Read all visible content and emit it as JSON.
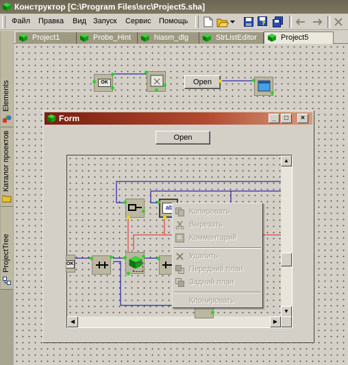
{
  "window": {
    "title": "Конструктор [C:\\Program Files\\src\\Project5.sha]"
  },
  "menu": [
    "Файл",
    "Правка",
    "Вид",
    "Запуск",
    "Сервис",
    "Помощь"
  ],
  "toolbar": {
    "icons": [
      "new-file-icon",
      "open-folder-icon",
      "dropdown-arrow-icon",
      "save-icon",
      "save-as-icon",
      "save-all-icon",
      "back-arrow-icon",
      "forward-arrow-icon",
      "close-icon"
    ]
  },
  "tabs": [
    {
      "label": "Project1",
      "active": false
    },
    {
      "label": "Probe_Hint",
      "active": false
    },
    {
      "label": "hiasm_dlg",
      "active": false
    },
    {
      "label": "StrListEditor",
      "active": false
    },
    {
      "label": "Project5",
      "active": true
    }
  ],
  "sidebar": [
    {
      "label": "Elements",
      "icon": "elements-icon"
    },
    {
      "label": "Каталог проектов",
      "icon": "folder-icon"
    },
    {
      "label": "ProjectTree",
      "icon": "tree-icon"
    }
  ],
  "canvas": {
    "ok_label": "OK",
    "open_button": "Open"
  },
  "form": {
    "title": "Form",
    "open_button": "Open",
    "caption_buttons": [
      "_",
      "□",
      "×"
    ],
    "ok_label": "OK",
    "edit_label": "ab"
  },
  "context_menu": {
    "items": [
      {
        "label": "Копировать",
        "icon": "copy-icon"
      },
      {
        "label": "Вырезать",
        "icon": "cut-icon"
      },
      {
        "label": "Комментарий",
        "icon": "comment-icon"
      },
      {
        "separator": true
      },
      {
        "label": "Удалить",
        "icon": "delete-icon"
      },
      {
        "label": "Передний план",
        "icon": "bring-front-icon"
      },
      {
        "label": "Задний план",
        "icon": "send-back-icon"
      },
      {
        "separator": true
      },
      {
        "label": "Клонировать",
        "icon": ""
      }
    ]
  },
  "colors": {
    "titlebar": "#6b6552",
    "form_title_start": "#7a1e10",
    "form_title_end": "#d89a7c",
    "link_blue": "#0000a0",
    "link_red": "#e02020",
    "point_green": "#2bd12b",
    "point_yellow": "#e8d800",
    "disabled_text": "#a09d90"
  }
}
